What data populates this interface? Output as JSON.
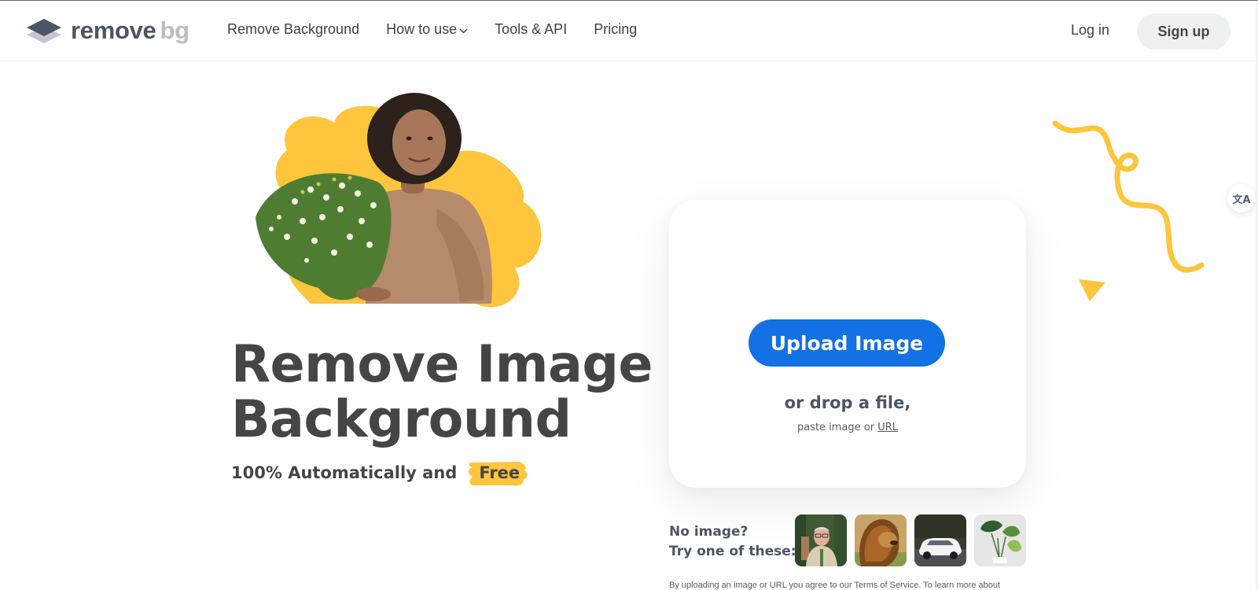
{
  "brand": {
    "name_primary": "remove",
    "name_secondary": "bg",
    "accent_blue": "#1271e4",
    "accent_yellow": "#ffc53d"
  },
  "nav": {
    "items": [
      {
        "label": "Remove Background",
        "has_dropdown": false
      },
      {
        "label": "How to use",
        "has_dropdown": true
      },
      {
        "label": "Tools & API",
        "has_dropdown": false
      },
      {
        "label": "Pricing",
        "has_dropdown": false
      }
    ],
    "login_label": "Log in",
    "signup_label": "Sign up"
  },
  "hero": {
    "title_line1": "Remove Image",
    "title_line2": "Background",
    "subtitle": "100% Automatically and",
    "subtitle_highlight": "Free",
    "image_alt": "Woman holding a bouquet of wildflowers"
  },
  "upload": {
    "button_label": "Upload Image",
    "drop_text": "or drop a file,",
    "paste_text": "paste image or",
    "url_label": "URL"
  },
  "samples": {
    "label_line1": "No image?",
    "label_line2": "Try one of these:",
    "items": [
      {
        "name": "person",
        "alt": "Smiling man with glasses"
      },
      {
        "name": "lion",
        "alt": "Lion"
      },
      {
        "name": "car",
        "alt": "White car"
      },
      {
        "name": "plant",
        "alt": "Potted monstera plant"
      }
    ]
  },
  "legal": {
    "terms_text": "By uploading an image or URL you agree to our Terms of Service. To learn more about"
  },
  "icons": {
    "translate": "文A"
  }
}
